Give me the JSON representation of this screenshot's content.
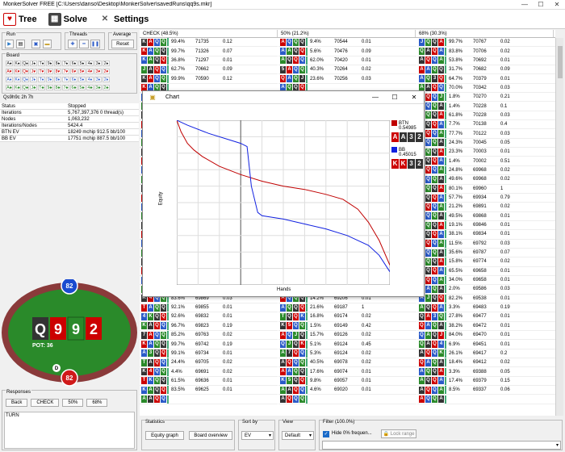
{
  "window": {
    "title": "MonkerSolver FREE [C:\\Users\\danso\\Desktop\\MonkerSolver\\savedRuns\\qq9s.mkr]"
  },
  "menu": {
    "tree": "Tree",
    "solve": "Solve",
    "settings": "Settings"
  },
  "run": {
    "label": "Run"
  },
  "threads": {
    "label": "Threads"
  },
  "average": {
    "label": "Average",
    "reset": "Reset"
  },
  "board": {
    "label": "Board",
    "rows": [
      [
        "A♠",
        "K♠",
        "Q♠",
        "J♠",
        "T♠",
        "9♠",
        "8♠",
        "7♠",
        "6♠",
        "5♠",
        "4♠",
        "3♠",
        "2♠"
      ],
      [
        "A♥",
        "K♥",
        "Q♥",
        "J♥",
        "T♥",
        "9♥",
        "8♥",
        "7♥",
        "6♥",
        "5♥",
        "4♥",
        "3♥",
        "2♥"
      ],
      [
        "A♦",
        "K♦",
        "Q♦",
        "J♦",
        "T♦",
        "9♦",
        "8♦",
        "7♦",
        "6♦",
        "5♦",
        "4♦",
        "3♦",
        "2♦"
      ],
      [
        "A♣",
        "K♣",
        "Q♣",
        "J♣",
        "T♣",
        "9♣",
        "8♣",
        "7♣",
        "6♣",
        "5♣",
        "4♣",
        "3♣",
        "2♣"
      ]
    ],
    "current": "Qs9h9c 2h 7h"
  },
  "stats": [
    {
      "k": "Status",
      "v": "Stopped"
    },
    {
      "k": "Iterations",
      "v": "5,767,397,376    0 thread(s)"
    },
    {
      "k": "Nodes",
      "v": "1,063,232"
    },
    {
      "k": "Iterations/Nodes",
      "v": "5424.4"
    },
    {
      "k": "BTN EV",
      "v": "18249 mchip    912.5 bb/100"
    },
    {
      "k": "BB EV",
      "v": "17751 mchip    887.5 bb/100"
    }
  ],
  "table_headers": [
    "CHECK (48.5%)",
    "50% (21.2%)",
    "68% (30.3%)"
  ],
  "rows": [
    [
      [
        "K",
        "A",
        "Q",
        "Q"
      ],
      "99.4%",
      "71735",
      "0.12",
      [
        "A",
        "Q",
        "Q",
        "Q"
      ],
      "9.4%",
      "70544",
      "0.01",
      [
        "J",
        "Q",
        "Q",
        "A"
      ],
      "99.7%",
      "70767",
      "0.02"
    ],
    [
      [
        "K",
        "A",
        "Q",
        "Q"
      ],
      "99.7%",
      "71326",
      "0.07",
      [
        "A",
        "A",
        "Q",
        "Q"
      ],
      "5.6%",
      "70476",
      "0.09",
      [
        "Q",
        "A",
        "Q",
        "A"
      ],
      "83.8%",
      "70706",
      "0.02"
    ],
    [
      [
        "K",
        "A",
        "Q",
        "Q"
      ],
      "36.8%",
      "71297",
      "0.01",
      [
        "A",
        "Q",
        "Q",
        "Q"
      ],
      "62.0%",
      "70420",
      "0.01",
      [
        "A",
        "Q",
        "Q",
        "A"
      ],
      "53.8%",
      "70692",
      "0.01"
    ],
    [
      [
        "J",
        "A",
        "Q",
        "Q"
      ],
      "62.7%",
      "70662",
      "0.09",
      [
        "5",
        "A",
        "Q",
        "Q"
      ],
      "40.3%",
      "70264",
      "0.02",
      [
        "A",
        "A",
        "Q",
        "Q"
      ],
      "31.7%",
      "70682",
      "0.09"
    ],
    [
      [
        "K",
        "A",
        "Q",
        "Q"
      ],
      "99.9%",
      "70590",
      "0.12",
      [
        "Q",
        "A",
        "Q",
        "J"
      ],
      "23.6%",
      "70256",
      "0.03",
      [
        "A",
        "Q",
        "3",
        "Q"
      ],
      "64.7%",
      "70379",
      "0.01"
    ],
    [
      [
        "K",
        "A",
        "Q",
        "Q"
      ],
      "",
      "",
      "",
      [
        "A",
        "Q",
        "Q",
        "Q"
      ],
      "",
      "",
      "",
      [
        "A",
        "A",
        "Q",
        "Q"
      ],
      "70.0%",
      "70342",
      "0.03"
    ],
    [
      [
        "K",
        "A",
        "Q",
        "Q"
      ],
      "",
      "",
      "",
      [
        "A",
        "Q",
        "Q",
        "Q"
      ],
      "",
      "",
      "",
      [
        "A",
        "Q",
        "Q",
        "J"
      ],
      "1.8%",
      "70270",
      "0.21"
    ],
    [
      [
        "K",
        "A",
        "Q",
        "Q"
      ],
      "",
      "",
      "",
      [
        "A",
        "Q",
        "Q",
        "Q"
      ],
      "",
      "",
      "",
      [
        "J",
        "Q",
        "Q",
        "A"
      ],
      "1.4%",
      "70228",
      "0.1"
    ],
    [
      [
        "K",
        "A",
        "Q",
        "Q"
      ],
      "",
      "",
      "",
      [
        "A",
        "Q",
        "Q",
        "Q"
      ],
      "",
      "",
      "",
      [
        "A",
        "Q",
        "Q",
        "A"
      ],
      "61.8%",
      "70228",
      "0.03"
    ],
    [
      [
        "K",
        "A",
        "Q",
        "Q"
      ],
      "",
      "",
      "",
      [
        "A",
        "Q",
        "Q",
        "Q"
      ],
      "",
      "",
      "",
      [
        "A",
        "Q",
        "Q",
        "A"
      ],
      "7.7%",
      "70138",
      "0.4"
    ],
    [
      [
        "K",
        "A",
        "Q",
        "Q"
      ],
      "",
      "",
      "",
      [
        "A",
        "Q",
        "Q",
        "Q"
      ],
      "",
      "",
      "",
      [
        "A",
        "Q",
        "Q",
        "A"
      ],
      "77.7%",
      "70122",
      "0.03"
    ],
    [
      [
        "K",
        "A",
        "Q",
        "Q"
      ],
      "",
      "",
      "",
      [
        "A",
        "Q",
        "Q",
        "Q"
      ],
      "",
      "",
      "",
      [
        "A",
        "Q",
        "Q",
        "A"
      ],
      "24.3%",
      "70045",
      "0.05"
    ],
    [
      [
        "K",
        "A",
        "Q",
        "Q"
      ],
      "",
      "",
      "",
      [
        "A",
        "Q",
        "Q",
        "Q"
      ],
      "",
      "",
      "",
      [
        "A",
        "Q",
        "Q",
        "A"
      ],
      "23.3%",
      "70003",
      "0.01"
    ],
    [
      [
        "K",
        "A",
        "Q",
        "Q"
      ],
      "",
      "",
      "",
      [
        "A",
        "Q",
        "Q",
        "Q"
      ],
      "",
      "",
      "",
      [
        "A",
        "Q",
        "Q",
        "A"
      ],
      "1.4%",
      "70002",
      "0.51"
    ],
    [
      [
        "K",
        "A",
        "Q",
        "Q"
      ],
      "",
      "",
      "",
      [
        "A",
        "Q",
        "Q",
        "Q"
      ],
      "",
      "",
      "",
      [
        "A",
        "Q",
        "Q",
        "A"
      ],
      "24.8%",
      "69968",
      "0.02"
    ],
    [
      [
        "K",
        "A",
        "Q",
        "Q"
      ],
      "",
      "",
      "",
      [
        "A",
        "Q",
        "Q",
        "Q"
      ],
      "",
      "",
      "",
      [
        "A",
        "Q",
        "Q",
        "A"
      ],
      "49.6%",
      "69968",
      "0.02"
    ],
    [
      [
        "K",
        "A",
        "Q",
        "Q"
      ],
      "",
      "",
      "",
      [
        "A",
        "Q",
        "Q",
        "Q"
      ],
      "",
      "",
      "",
      [
        "A",
        "Q",
        "Q",
        "A"
      ],
      "80.1%",
      "69960",
      "1"
    ],
    [
      [
        "K",
        "A",
        "Q",
        "Q"
      ],
      "",
      "",
      "",
      [
        "A",
        "Q",
        "Q",
        "Q"
      ],
      "",
      "",
      "",
      [
        "A",
        "Q",
        "Q",
        "A"
      ],
      "57.7%",
      "69934",
      "0.79"
    ],
    [
      [
        "K",
        "A",
        "Q",
        "Q"
      ],
      "",
      "",
      "",
      [
        "A",
        "Q",
        "Q",
        "Q"
      ],
      "",
      "",
      "",
      [
        "A",
        "Q",
        "Q",
        "A"
      ],
      "21.2%",
      "69891",
      "0.02"
    ],
    [
      [
        "K",
        "A",
        "Q",
        "Q"
      ],
      "",
      "",
      "",
      [
        "A",
        "Q",
        "Q",
        "Q"
      ],
      "",
      "",
      "",
      [
        "A",
        "Q",
        "Q",
        "A"
      ],
      "49.5%",
      "69868",
      "0.01"
    ],
    [
      [
        "K",
        "A",
        "Q",
        "Q"
      ],
      "",
      "",
      "",
      [
        "A",
        "Q",
        "Q",
        "Q"
      ],
      "",
      "",
      "",
      [
        "A",
        "Q",
        "Q",
        "A"
      ],
      "19.1%",
      "69846",
      "0.01"
    ],
    [
      [
        "K",
        "A",
        "Q",
        "Q"
      ],
      "",
      "",
      "",
      [
        "A",
        "Q",
        "Q",
        "Q"
      ],
      "",
      "",
      "",
      [
        "A",
        "Q",
        "Q",
        "A"
      ],
      "38.1%",
      "69834",
      "0.01"
    ],
    [
      [
        "K",
        "A",
        "Q",
        "Q"
      ],
      "",
      "",
      "",
      [
        "A",
        "Q",
        "Q",
        "Q"
      ],
      "",
      "",
      "",
      [
        "A",
        "Q",
        "Q",
        "A"
      ],
      "11.5%",
      "69792",
      "0.03"
    ],
    [
      [
        "K",
        "A",
        "Q",
        "Q"
      ],
      "",
      "",
      "",
      [
        "A",
        "Q",
        "Q",
        "Q"
      ],
      "",
      "",
      "",
      [
        "A",
        "Q",
        "Q",
        "A"
      ],
      "35.6%",
      "69787",
      "0.07"
    ],
    [
      [
        "K",
        "A",
        "Q",
        "Q"
      ],
      "",
      "",
      "",
      [
        "A",
        "Q",
        "Q",
        "Q"
      ],
      "",
      "",
      "",
      [
        "A",
        "Q",
        "Q",
        "A"
      ],
      "15.8%",
      "69774",
      "0.02"
    ],
    [
      [
        "K",
        "A",
        "Q",
        "Q"
      ],
      "",
      "",
      "",
      [
        "A",
        "Q",
        "Q",
        "Q"
      ],
      "",
      "",
      "",
      [
        "A",
        "Q",
        "Q",
        "A"
      ],
      "65.5%",
      "69658",
      "0.01"
    ],
    [
      [
        "K",
        "A",
        "Q",
        "Q"
      ],
      "",
      "",
      "",
      [
        "A",
        "Q",
        "Q",
        "Q"
      ],
      "",
      "",
      "",
      [
        "A",
        "Q",
        "Q",
        "A"
      ],
      "34.0%",
      "69658",
      "0.01"
    ],
    [
      [
        "Q",
        "K",
        "Q",
        "Q"
      ],
      "14.9%",
      "69921",
      "0.02",
      [
        "5",
        "J",
        "Q",
        "Q"
      ],
      "9.2%",
      "69208",
      "0.01",
      [
        "Q",
        "A",
        "Q",
        "A"
      ],
      "2.0%",
      "69586",
      "0.03"
    ],
    [
      [
        "K",
        "4",
        "Q",
        "Q"
      ],
      "83.6%",
      "69869",
      "0.03",
      [
        "A",
        "Q",
        "Q",
        "Q"
      ],
      "14.2%",
      "69206",
      "0.01",
      [
        "A",
        "J",
        "Q",
        "Q"
      ],
      "82.2%",
      "69538",
      "0.01"
    ],
    [
      [
        "T",
        "A",
        "Q",
        "Q"
      ],
      "92.1%",
      "69855",
      "0.01",
      [
        "A",
        "Q",
        "Q",
        "Q"
      ],
      "21.6%",
      "69187",
      "1",
      [
        "A",
        "Q",
        "Q",
        "A"
      ],
      "3.3%",
      "69483",
      "0.19"
    ],
    [
      [
        "4",
        "K",
        "Q",
        "Q"
      ],
      "92.6%",
      "69832",
      "0.01",
      [
        "T",
        "Q",
        "Q",
        "K"
      ],
      "16.8%",
      "69174",
      "0.02",
      [
        "Q",
        "A",
        "3",
        "Q"
      ],
      "27.8%",
      "69477",
      "0.01"
    ],
    [
      [
        "K",
        "A",
        "Q",
        "Q"
      ],
      "96.7%",
      "69823",
      "0.19",
      [
        "K",
        "5",
        "Q",
        "Q"
      ],
      "1.5%",
      "69149",
      "0.42",
      [
        "Q",
        "A",
        "Q",
        "A"
      ],
      "38.2%",
      "69472",
      "0.01"
    ],
    [
      [
        "7",
        "A",
        "Q",
        "Q"
      ],
      "85.2%",
      "69763",
      "0.02",
      [
        "A",
        "Q",
        "J",
        "Q"
      ],
      "15.7%",
      "69126",
      "0.02",
      [
        "Q",
        "A",
        "Q",
        "J"
      ],
      "84.0%",
      "69470",
      "0.01"
    ],
    [
      [
        "K",
        "A",
        "Q",
        "Q"
      ],
      "99.7%",
      "69742",
      "0.19",
      [
        "Q",
        "J",
        "Q",
        "K"
      ],
      "5.1%",
      "69124",
      "0.45",
      [
        "Q",
        "A",
        "Q",
        "4"
      ],
      "6.9%",
      "69451",
      "0.01"
    ],
    [
      [
        "A",
        "3",
        "Q",
        "Q"
      ],
      "99.1%",
      "69734",
      "0.01",
      [
        "A",
        "7",
        "Q",
        "Q"
      ],
      "5.3%",
      "69124",
      "0.02",
      [
        "A",
        "Q",
        "Q",
        "K"
      ],
      "26.1%",
      "69417",
      "0.2"
    ],
    [
      [
        "T",
        "A",
        "Q",
        "Q"
      ],
      "24.4%",
      "69705",
      "0.02",
      [
        "A",
        "Q",
        "Q",
        "Q"
      ],
      "40.5%",
      "69078",
      "0.02",
      [
        "Q",
        "A",
        "Q",
        "A"
      ],
      "18.4%",
      "69412",
      "0.02"
    ],
    [
      [
        "K",
        "4",
        "Q",
        "Q"
      ],
      "4.4%",
      "69691",
      "0.02",
      [
        "A",
        "A",
        "Q",
        "Q"
      ],
      "17.6%",
      "69074",
      "0.01",
      [
        "A",
        "Q",
        "Q",
        "A"
      ],
      "3.3%",
      "69388",
      "0.05"
    ],
    [
      [
        "T",
        "K",
        "Q",
        "Q"
      ],
      "61.5%",
      "69636",
      "0.01",
      [
        "K",
        "5",
        "Q",
        "Q"
      ],
      "9.8%",
      "69057",
      "0.01",
      [
        "A",
        "Q",
        "Q",
        "A"
      ],
      "17.4%",
      "69379",
      "0.15"
    ],
    [
      [
        "K",
        "A",
        "Q",
        "Q"
      ],
      "83.5%",
      "69625",
      "0.01",
      [
        "A",
        "A",
        "Q",
        "Q"
      ],
      "4.6%",
      "69020",
      "0.01",
      [
        "A",
        "Q",
        "Q",
        "A"
      ],
      "8.5%",
      "69337",
      "0.06"
    ],
    [
      [
        "A",
        "A",
        "Q",
        "Q"
      ],
      "",
      "",
      "",
      [
        "A",
        "Q",
        "Q",
        "Q"
      ],
      "",
      "",
      "",
      [
        "A",
        "Q",
        "Q",
        "A"
      ],
      "",
      "",
      ""
    ]
  ],
  "chart": {
    "window_title": "Chart",
    "ylabel": "Equity",
    "xlabel": "Hands",
    "legend": [
      {
        "name": "BTN",
        "value": "0.54985",
        "color": "#c00000",
        "cards": [
          "A",
          "A",
          "3",
          "2"
        ]
      },
      {
        "name": "BB",
        "value": "0.45015",
        "color": "#1020e0",
        "cards": [
          "K",
          "K",
          "3",
          "2"
        ]
      }
    ]
  },
  "chart_data": {
    "type": "line",
    "xlabel": "Hands",
    "ylabel": "Equity",
    "xlim": [
      0,
      1
    ],
    "ylim": [
      0,
      1
    ],
    "series": [
      {
        "name": "BTN",
        "x": [
          0,
          0.02,
          0.05,
          0.08,
          0.12,
          0.2,
          0.3,
          0.4,
          0.5,
          0.6,
          0.7,
          0.78,
          0.85,
          0.9,
          0.95,
          1.0
        ],
        "y": [
          1.0,
          0.93,
          0.86,
          0.82,
          0.78,
          0.72,
          0.67,
          0.63,
          0.6,
          0.58,
          0.55,
          0.52,
          0.46,
          0.38,
          0.27,
          0.12
        ]
      },
      {
        "name": "BB",
        "x": [
          0,
          0.05,
          0.15,
          0.25,
          0.3,
          0.33,
          0.35,
          0.38,
          0.4,
          0.5,
          0.6,
          0.7,
          0.8,
          0.9,
          0.95,
          1.0
        ],
        "y": [
          1.0,
          0.97,
          0.92,
          0.88,
          0.86,
          0.84,
          0.6,
          0.44,
          0.42,
          0.4,
          0.37,
          0.34,
          0.3,
          0.24,
          0.18,
          0.08
        ]
      }
    ]
  },
  "pokertable": {
    "top_stack": "82",
    "bottom_stack": "82",
    "board": [
      "Q",
      "9",
      "9",
      "2"
    ],
    "pot": "POT: 36",
    "dealer": "D"
  },
  "responses": {
    "label": "Responses",
    "buttons": [
      "Back",
      "CHECK",
      "50%",
      "68%"
    ],
    "text": "TURN"
  },
  "bottom": {
    "statistics": "Statistics",
    "equity_graph": "Equity graph",
    "board_overview": "Board overview",
    "sort_by": "Sort by",
    "sort_value": "EV",
    "view": "View",
    "view_value": "Default",
    "filter": "Filter (100.0%)",
    "hide_zero": "Hide 0% frequen...",
    "lock_range": "Lock range"
  }
}
